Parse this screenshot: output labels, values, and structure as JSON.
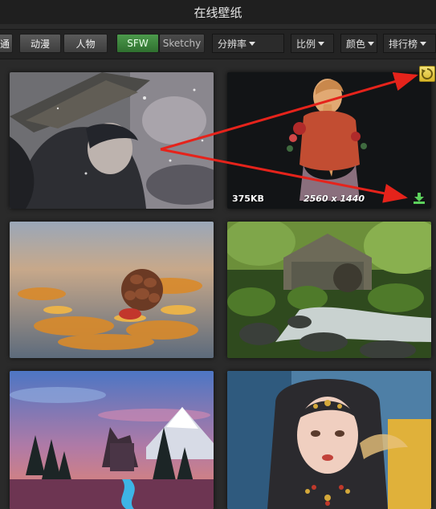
{
  "window": {
    "title": "在线壁纸"
  },
  "toolbar": {
    "category_buttons": [
      "通",
      "动漫",
      "人物"
    ],
    "purity": {
      "sfw": "SFW",
      "sketchy": "Sketchy"
    },
    "dropdowns": {
      "resolution": "分辨率",
      "ratio": "比例",
      "color": "颜色",
      "sort": "排行榜"
    }
  },
  "wallpapers": [
    {
      "id": "w1",
      "subject": "anime girl with straw hat in snow"
    },
    {
      "id": "w2",
      "subject": "girl with braided hair and flowers",
      "size": "375KB",
      "resolution": "2560 x 1440"
    },
    {
      "id": "w3",
      "subject": "pine cone on autumn leaves"
    },
    {
      "id": "w4",
      "subject": "mossy forest stream with stone mill"
    },
    {
      "id": "w5",
      "subject": "castle at sunset with pine trees"
    },
    {
      "id": "w6",
      "subject": "fantasy girl with jewelry"
    }
  ],
  "icons": {
    "download": "download-icon",
    "refresh": "refresh-icon"
  },
  "colors": {
    "accent_green": "#3f8f3f",
    "refresh_yellow": "#e8ca45",
    "annotation_red": "#e5231b"
  }
}
